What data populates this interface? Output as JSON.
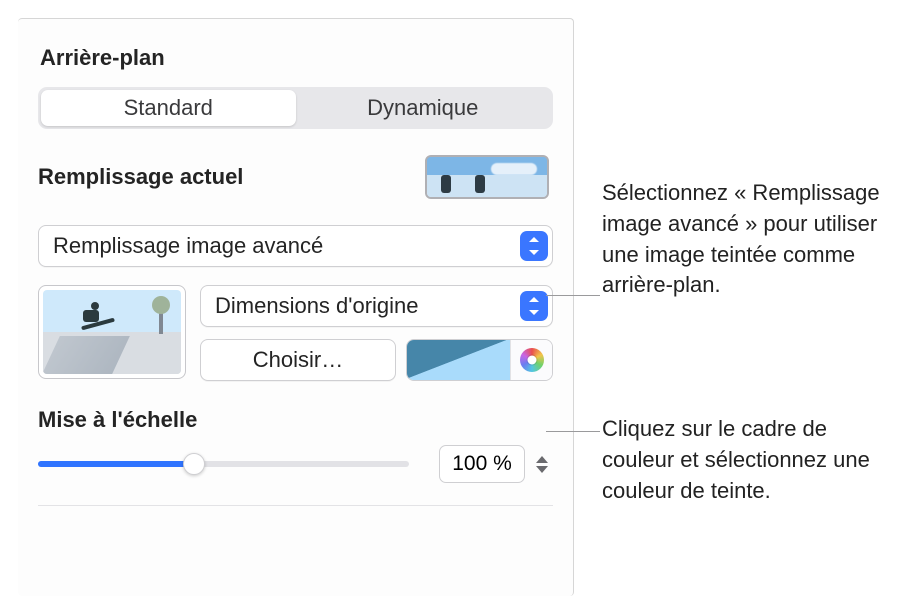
{
  "section_title": "Arrière-plan",
  "tabs": {
    "standard": "Standard",
    "dynamic": "Dynamique"
  },
  "current_fill_label": "Remplissage actuel",
  "fill_type_popup": "Remplissage image avancé",
  "scale_popup": "Dimensions d'origine",
  "choose_button": "Choisir…",
  "scale_section_label": "Mise à l'échelle",
  "scale_value": "100 %",
  "callouts": {
    "fill_type": "Sélectionnez « Remplissage image avancé » pour utiliser une image teintée comme arrière-plan.",
    "tint": "Cliquez sur le cadre de couleur et sélectionnez une couleur de teinte."
  }
}
